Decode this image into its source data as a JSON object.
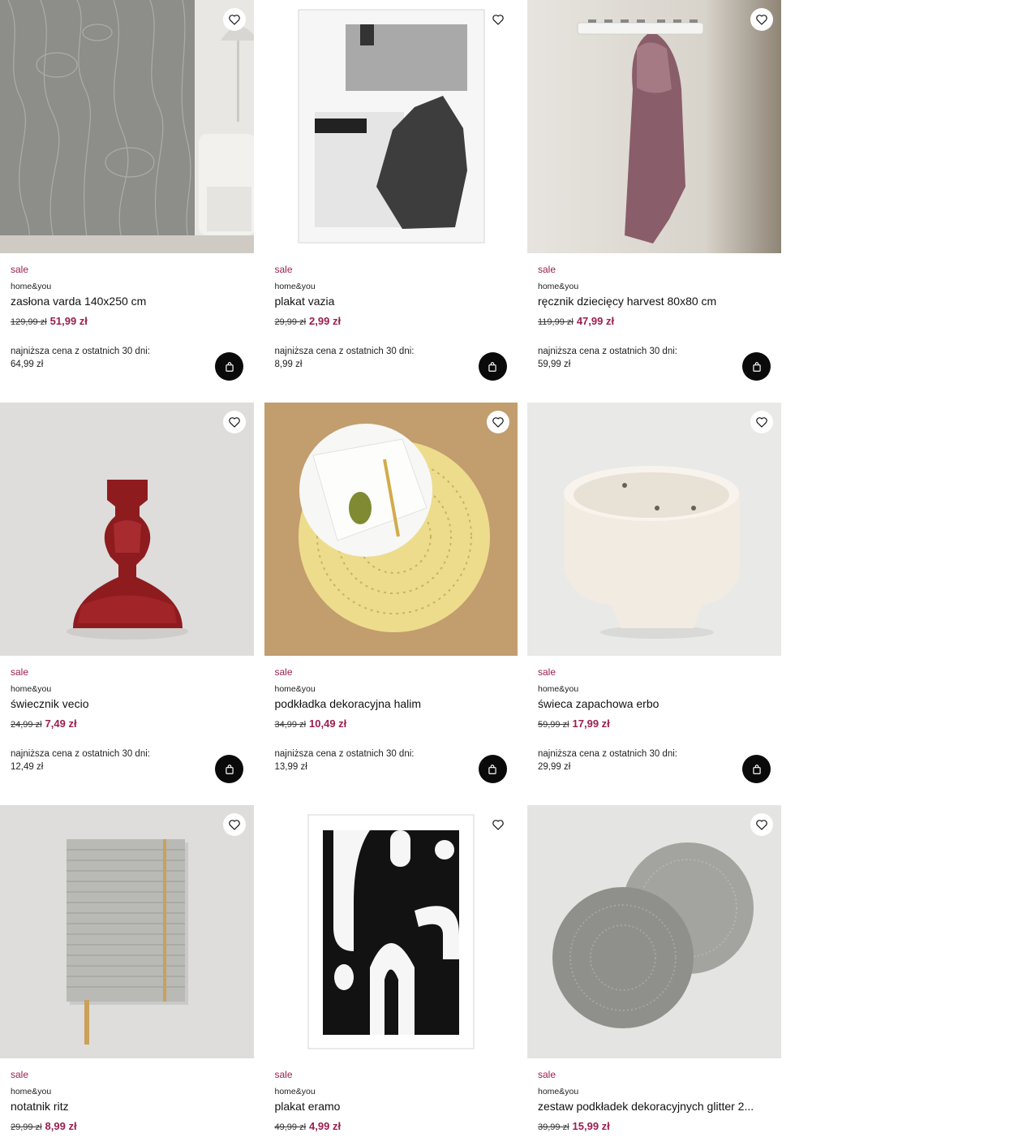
{
  "colors": {
    "accent": "#9b1e4f",
    "cart_bg": "#0a0a0a",
    "text": "#1a1a1a"
  },
  "products": [
    {
      "sale": "sale",
      "brand": "home&you",
      "name": "zasłona varda 140x250 cm",
      "old_price": "129,99 zł",
      "new_price": "51,99 zł",
      "lowest_label": "najniższa cena z ostatnich 30 dni:",
      "lowest_price": "64,99 zł"
    },
    {
      "sale": "sale",
      "brand": "home&you",
      "name": "plakat vazia",
      "old_price": "29,99 zł",
      "new_price": "2,99 zł",
      "lowest_label": "najniższa cena z ostatnich 30 dni:",
      "lowest_price": "8,99 zł"
    },
    {
      "sale": "sale",
      "brand": "home&you",
      "name": "ręcznik dziecięcy harvest 80x80 cm",
      "old_price": "119,99 zł",
      "new_price": "47,99 zł",
      "lowest_label": "najniższa cena z ostatnich 30 dni:",
      "lowest_price": "59,99 zł"
    },
    {
      "sale": "sale",
      "brand": "home&you",
      "name": "świecznik vecio",
      "old_price": "24,99 zł",
      "new_price": "7,49 zł",
      "lowest_label": "najniższa cena z ostatnich 30 dni:",
      "lowest_price": "12,49 zł"
    },
    {
      "sale": "sale",
      "brand": "home&you",
      "name": "podkładka dekoracyjna halim",
      "old_price": "34,99 zł",
      "new_price": "10,49 zł",
      "lowest_label": "najniższa cena z ostatnich 30 dni:",
      "lowest_price": "13,99 zł"
    },
    {
      "sale": "sale",
      "brand": "home&you",
      "name": "świeca zapachowa erbo",
      "old_price": "59,99 zł",
      "new_price": "17,99 zł",
      "lowest_label": "najniższa cena z ostatnich 30 dni:",
      "lowest_price": "29,99 zł"
    },
    {
      "sale": "sale",
      "brand": "home&you",
      "name": "notatnik ritz",
      "old_price": "29,99 zł",
      "new_price": "8,99 zł"
    },
    {
      "sale": "sale",
      "brand": "home&you",
      "name": "plakat eramo",
      "old_price": "49,99 zł",
      "new_price": "4,99 zł"
    },
    {
      "sale": "sale",
      "brand": "home&you",
      "name": "zestaw podkładek dekoracyjnych glitter 2...",
      "old_price": "39,99 zł",
      "new_price": "15,99 zł"
    }
  ],
  "icons": {
    "favorite": "heart-icon",
    "cart": "shopping-bag-icon"
  }
}
